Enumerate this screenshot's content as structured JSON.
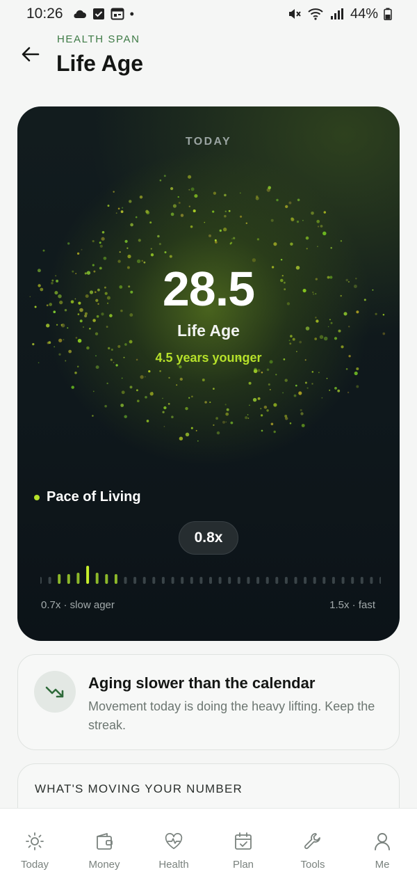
{
  "status_bar": {
    "time": "10:26",
    "battery": "44%",
    "dot": "•"
  },
  "header": {
    "eyebrow": "HEALTH SPAN",
    "title": "Life Age",
    "back_icon": "arrow-left-icon"
  },
  "hero": {
    "period": "TODAY",
    "value": "28.5",
    "label": "Life Age",
    "delta": "4.5 years younger",
    "pace_label": "Pace of Living",
    "pace_value": "0.8x",
    "scale_min": "0.7x · slow ager",
    "scale_max": "1.5x · fast",
    "colors": {
      "accent": "#b6e12a",
      "card_bg": "#0f181c"
    }
  },
  "insight": {
    "icon": "trending-down-icon",
    "title": "Aging slower than the calendar",
    "body": "Movement today is doing the heavy lifting. Keep the streak."
  },
  "moving": {
    "title": "WHAT'S MOVING YOUR NUMBER"
  },
  "nav": {
    "items": [
      {
        "label": "Today",
        "icon": "sun-icon"
      },
      {
        "label": "Money",
        "icon": "wallet-icon"
      },
      {
        "label": "Health",
        "icon": "heart-pulse-icon"
      },
      {
        "label": "Plan",
        "icon": "calendar-check-icon"
      },
      {
        "label": "Tools",
        "icon": "wrench-icon"
      },
      {
        "label": "Me",
        "icon": "user-icon"
      }
    ]
  }
}
